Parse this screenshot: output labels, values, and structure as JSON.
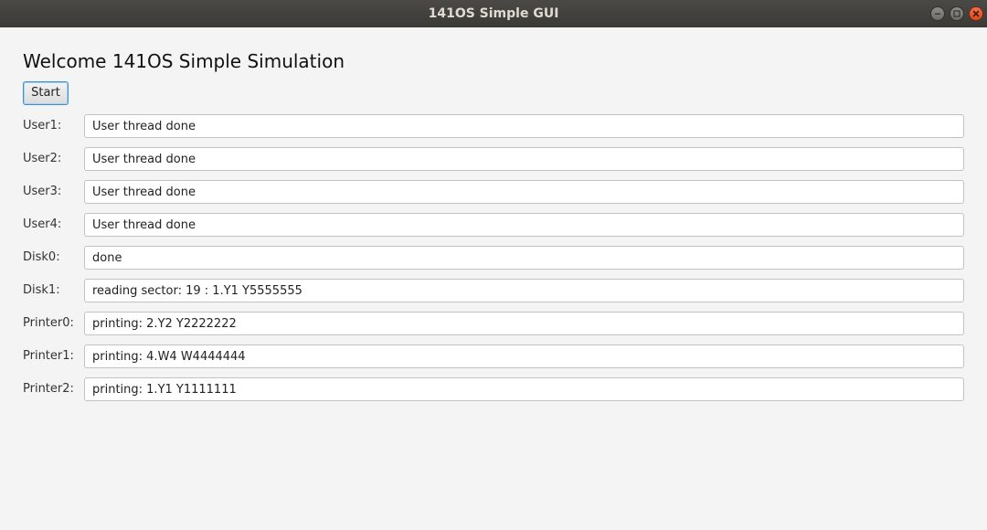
{
  "window": {
    "title": "141OS Simple GUI",
    "controls": [
      "minimize-icon",
      "maximize-icon",
      "close-icon"
    ]
  },
  "main": {
    "heading": "Welcome 141OS Simple Simulation",
    "start_label": "Start",
    "rows": [
      {
        "label": "User1:",
        "value": "User thread done"
      },
      {
        "label": "User2:",
        "value": "User thread done"
      },
      {
        "label": "User3:",
        "value": "User thread done"
      },
      {
        "label": "User4:",
        "value": "User thread done"
      },
      {
        "label": "Disk0:",
        "value": "done"
      },
      {
        "label": "Disk1:",
        "value": "reading sector: 19 : 1.Y1 Y5555555"
      },
      {
        "label": "Printer0:",
        "value": "printing: 2.Y2 Y2222222"
      },
      {
        "label": "Printer1:",
        "value": "printing: 4.W4 W4444444"
      },
      {
        "label": "Printer2:",
        "value": "printing: 1.Y1 Y1111111"
      }
    ]
  },
  "colors": {
    "titlebar": "#3b3a36",
    "close_button": "#e95420",
    "focus_border": "#3b8fd6",
    "background": "#f4f4f4"
  }
}
